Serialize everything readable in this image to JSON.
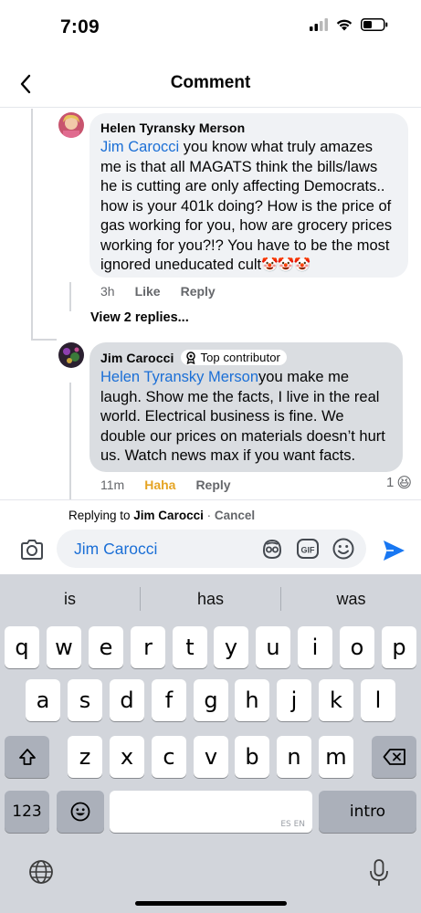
{
  "status_bar": {
    "time": "7:09"
  },
  "header": {
    "title": "Comment"
  },
  "comments": [
    {
      "author": "Helen Tyransky Merson",
      "mention": "Jim Carocci",
      "text": " you know what truly amazes me is that all MAGATS think the bills/laws he is cutting are only affecting Democrats.. how is your 401k doing? How is the price of gas working for you, how are grocery prices working for you?!? You have to be the most ignored uneducated cult",
      "emoji": "🤡🤡🤡",
      "time": "3h",
      "like_label": "Like",
      "reply_label": "Reply"
    },
    {
      "author": "Jim Carocci",
      "badge": "Top contributor",
      "mention": "Helen Tyransky Merson",
      "text": "you make me laugh. Show me the facts, I live in the real world. Electrical business is fine. We double our prices on materials doesn’t hurt us. Watch news max if you want facts.",
      "time": "11m",
      "reaction_label": "Haha",
      "reply_label": "Reply",
      "reaction_count": "1",
      "reaction_emoji": "😆"
    }
  ],
  "view_replies": "View 2 replies...",
  "replying_bar": {
    "prefix": "Replying to ",
    "name": "Jim Carocci",
    "separator": " · ",
    "cancel": "Cancel"
  },
  "input": {
    "value": "Jim Carocci"
  },
  "keyboard": {
    "suggestions": [
      "is",
      "has",
      "was"
    ],
    "row1": [
      "q",
      "w",
      "e",
      "r",
      "t",
      "y",
      "u",
      "i",
      "o",
      "p"
    ],
    "row2": [
      "a",
      "s",
      "d",
      "f",
      "g",
      "h",
      "j",
      "k",
      "l"
    ],
    "row3": [
      "z",
      "x",
      "c",
      "v",
      "b",
      "n",
      "m"
    ],
    "numbers_key": "123",
    "return_key": "intro",
    "space_lang": "ES EN"
  },
  "colors": {
    "mention": "#1b6fd6",
    "haha": "#e5a424",
    "send": "#1877f2"
  }
}
